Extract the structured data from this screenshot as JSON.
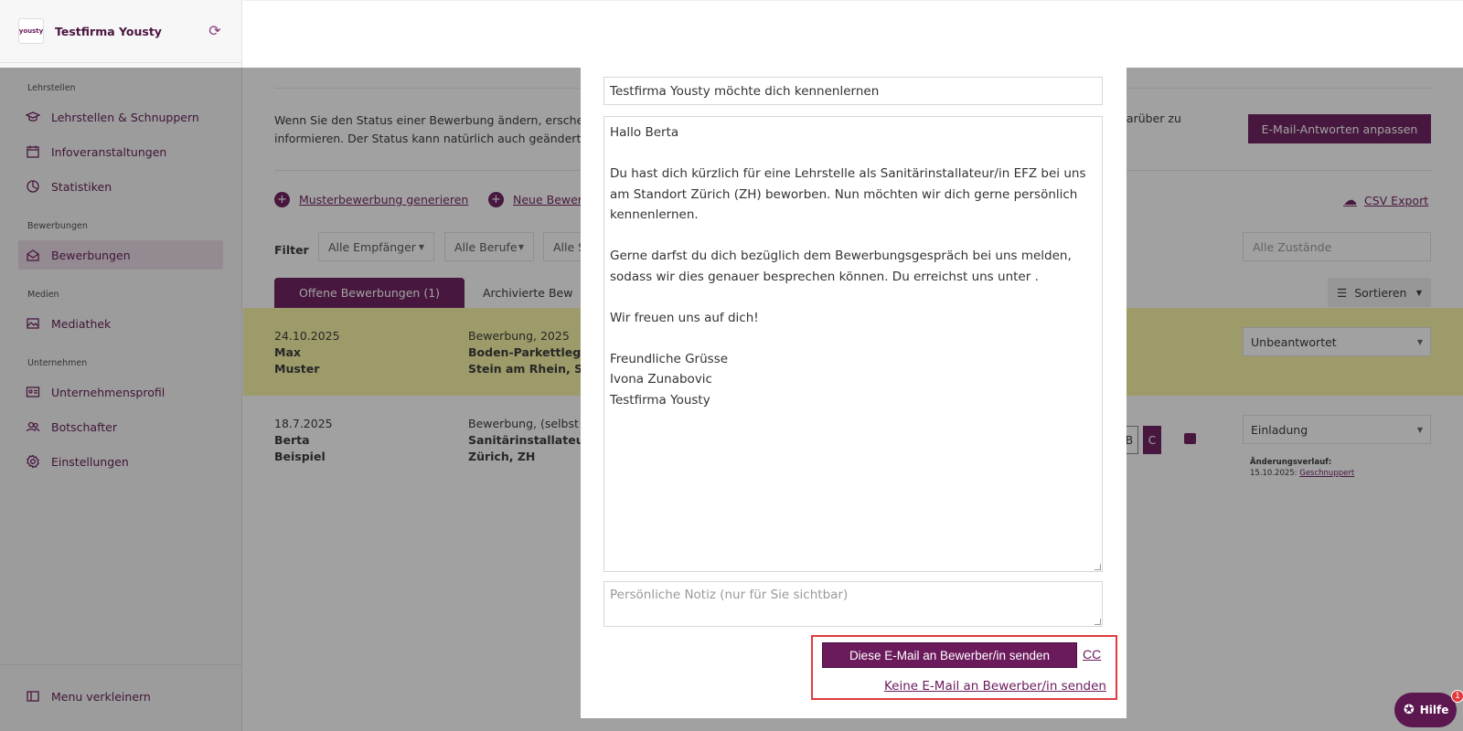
{
  "brand": {
    "logo_text": "yousty",
    "company": "Testfirma Yousty"
  },
  "sidebar": {
    "sections": [
      {
        "label": "Lehrstellen",
        "items": [
          {
            "label": "Lehrstellen & Schnuppern",
            "icon": "graduation-cap-icon"
          },
          {
            "label": "Infoveranstaltungen",
            "icon": "calendar-icon"
          },
          {
            "label": "Statistiken",
            "icon": "pie-chart-icon"
          }
        ]
      },
      {
        "label": "Bewerbungen",
        "items": [
          {
            "label": "Bewerbungen",
            "icon": "envelope-open-icon",
            "active": true
          }
        ]
      },
      {
        "label": "Medien",
        "items": [
          {
            "label": "Mediathek",
            "icon": "images-icon"
          }
        ]
      },
      {
        "label": "Unternehmen",
        "items": [
          {
            "label": "Unternehmensprofil",
            "icon": "id-card-icon"
          },
          {
            "label": "Botschafter",
            "icon": "users-icon"
          },
          {
            "label": "Einstellungen",
            "icon": "gear-icon"
          }
        ]
      }
    ],
    "collapse_label": "Menu verkleinern"
  },
  "page": {
    "info_text": "Wenn Sie den Status einer Bewerbung ändern, erschei informieren. Der Status kann natürlich auch geändert w",
    "info_text_right": "darüber zu",
    "email_answers_button": "E-Mail-Antworten anpassen",
    "generate_sample_link": "Musterbewerbung generieren",
    "new_application_link": "Neue Bewer",
    "csv_export_link": "CSV Export",
    "filter_label": "Filter",
    "filters": [
      "Alle Empfänger",
      "Alle Berufe",
      "Alle S"
    ],
    "states_filter": "Alle Zustände",
    "tab_open": "Offene Bewerbungen (1)",
    "tab_archived": "Archivierte Bew",
    "sort_label": "Sortieren",
    "rows": [
      {
        "date": "24.10.2025",
        "first": "Max",
        "last": "Muster",
        "type": "Bewerbung, 2025",
        "job": "Boden-Parkettleger",
        "place": "Stein am Rhein, SH",
        "status": "Unbeantwortet"
      },
      {
        "date": "18.7.2025",
        "first": "Berta",
        "last": "Beispiel",
        "type": "Bewerbung, (selbst",
        "job": "Sanitärinstallateur/",
        "place": "Zürich, ZH",
        "status": "Einladung",
        "history_label": "Änderungsverlauf:",
        "history_date": "15.10.2025:",
        "history_value": "Geschnuppert",
        "mini_b": "B",
        "mini_c": "C"
      }
    ]
  },
  "modal": {
    "subject": "Testfirma Yousty möchte dich kennenlernen",
    "body": "Hallo Berta\n\nDu hast dich kürzlich für eine Lehrstelle als Sanitärinstallateur/in EFZ bei uns am Standort Zürich (ZH) beworben. Nun möchten wir dich gerne persönlich kennenlernen.\n\nGerne darfst du dich bezüglich dem Bewerbungsgespräch bei uns melden, sodass wir dies genauer besprechen können. Du erreichst uns unter .\n\nWir freuen uns auf dich!\n\nFreundliche Grüsse\nIvona Zunabovic\nTestfirma Yousty",
    "note_placeholder": "Persönliche Notiz (nur für Sie sichtbar)",
    "send_button": "Diese E-Mail an Bewerber/in senden",
    "cc_link": "CC",
    "no_email_link": "Keine E-Mail an Bewerber/in senden"
  },
  "help": {
    "label": "Hilfe",
    "badge": "1"
  },
  "colors": {
    "brand": "#6b1a5c",
    "highlight_row": "#f8f6a2",
    "focus_border": "#e23b3b"
  }
}
